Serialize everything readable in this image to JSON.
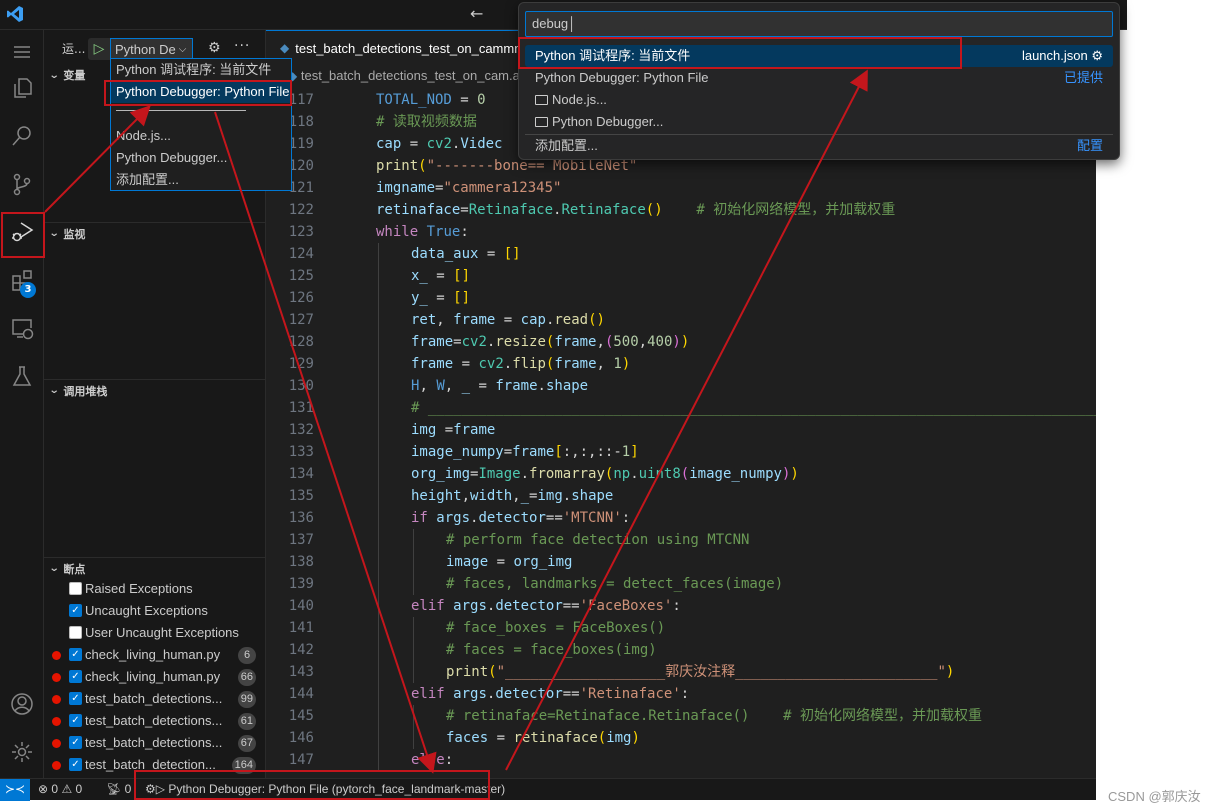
{
  "window": {
    "logo": "vscode-logo",
    "nav_back": "←",
    "nav_forward": "→"
  },
  "activity_bar": {
    "items": [
      {
        "name": "menu",
        "icon": "menu-icon"
      },
      {
        "name": "explorer",
        "icon": "files-icon"
      },
      {
        "name": "search",
        "icon": "search-icon"
      },
      {
        "name": "source-control",
        "icon": "source-control-icon"
      },
      {
        "name": "run-and-debug",
        "icon": "debug-icon",
        "active": true
      },
      {
        "name": "extensions",
        "icon": "extensions-icon",
        "badge": "3"
      },
      {
        "name": "remote-explorer",
        "icon": "remote-icon"
      },
      {
        "name": "testing",
        "icon": "flask-icon"
      },
      {
        "name": "accounts",
        "icon": "account-icon"
      },
      {
        "name": "settings",
        "icon": "gear-icon"
      }
    ]
  },
  "sidebar": {
    "title": "运...",
    "config_selected": "Python De",
    "sections": {
      "variables": "变量",
      "watch": "监视",
      "call_stack": "调用堆栈",
      "breakpoints": "断点"
    },
    "breakpoints": [
      {
        "label": "Raised Exceptions",
        "checked": false,
        "dot": false
      },
      {
        "label": "Uncaught Exceptions",
        "checked": true,
        "dot": false
      },
      {
        "label": "User Uncaught Exceptions",
        "checked": false,
        "dot": false
      },
      {
        "label": "check_living_human.py",
        "checked": true,
        "dot": true,
        "count": "6"
      },
      {
        "label": "check_living_human.py",
        "checked": true,
        "dot": true,
        "count": "66"
      },
      {
        "label": "test_batch_detections...",
        "checked": true,
        "dot": true,
        "count": "99"
      },
      {
        "label": "test_batch_detections...",
        "checked": true,
        "dot": true,
        "count": "61"
      },
      {
        "label": "test_batch_detections...",
        "checked": true,
        "dot": true,
        "count": "67"
      },
      {
        "label": "test_batch_detection...",
        "checked": true,
        "dot": true,
        "count": "164"
      }
    ]
  },
  "config_dropdown": {
    "items": [
      {
        "label": "Python 调试程序: 当前文件",
        "selected": false
      },
      {
        "label": "Python Debugger: Python File",
        "selected": true
      },
      {
        "label": "——————————",
        "separator": true
      },
      {
        "label": "Node.js...",
        "selected": false
      },
      {
        "label": "Python Debugger...",
        "selected": false
      },
      {
        "label": "添加配置...",
        "selected": false
      }
    ]
  },
  "editor": {
    "tab_label": "test_batch_detections_test_on_cammm",
    "breadcrumb": "test_batch_detections_test_on_cam.ar",
    "lines": [
      {
        "n": "117",
        "html": "<span class='b'>TOTAL_NOD</span> <span class='w'>=</span> <span class='n'>0</span>",
        "indent": 0
      },
      {
        "n": "118",
        "html": "<span class='c'># 读取视频数据</span>",
        "indent": 0
      },
      {
        "n": "119",
        "html": "<span class='v'>cap</span> <span class='w'>=</span> <span class='t'>cv2</span><span class='w'>.</span><span class='v'>Videc</span>",
        "indent": 0
      },
      {
        "n": "120",
        "html": "<span class='f'>print</span><span class='p'>(</span><span class='s'>\"-------bone== MobileNet\"</span>",
        "indent": 0
      },
      {
        "n": "121",
        "html": "<span class='v'>imgname</span><span class='w'>=</span><span class='s'>\"cammera12345\"</span>",
        "indent": 0
      },
      {
        "n": "122",
        "html": "<span class='v'>retinaface</span><span class='w'>=</span><span class='t'>Retinaface</span><span class='w'>.</span><span class='t'>Retinaface</span><span class='p'>()</span>    <span class='c'># 初始化网络模型，并加载权重</span>",
        "indent": 0
      },
      {
        "n": "123",
        "html": "<span class='k'>while</span> <span class='b'>True</span><span class='w'>:</span>",
        "indent": 0
      },
      {
        "n": "124",
        "html": "<span class='v'>data_aux</span> <span class='w'>=</span> <span class='p'>[]</span>",
        "indent": 1
      },
      {
        "n": "125",
        "html": "<span class='v'>x_</span> <span class='w'>=</span> <span class='p'>[]</span>",
        "indent": 1
      },
      {
        "n": "126",
        "html": "<span class='v'>y_</span> <span class='w'>=</span> <span class='p'>[]</span>",
        "indent": 1
      },
      {
        "n": "127",
        "html": "<span class='v'>ret</span><span class='w'>,</span> <span class='v'>frame</span> <span class='w'>=</span> <span class='v'>cap</span><span class='w'>.</span><span class='f'>read</span><span class='p'>()</span>",
        "indent": 1
      },
      {
        "n": "128",
        "html": "<span class='v'>frame</span><span class='w'>=</span><span class='t'>cv2</span><span class='w'>.</span><span class='f'>resize</span><span class='p'>(</span><span class='v'>frame</span><span class='w'>,</span><span class='p2'>(</span><span class='n'>500</span><span class='w'>,</span><span class='n'>400</span><span class='p2'>)</span><span class='p'>)</span>",
        "indent": 1
      },
      {
        "n": "129",
        "html": "<span class='v'>frame</span> <span class='w'>=</span> <span class='t'>cv2</span><span class='w'>.</span><span class='f'>flip</span><span class='p'>(</span><span class='v'>frame</span><span class='w'>,</span> <span class='n'>1</span><span class='p'>)</span>",
        "indent": 1
      },
      {
        "n": "130",
        "html": "<span class='b'>H</span><span class='w'>,</span> <span class='b'>W</span><span class='w'>,</span> <span class='v'>_</span> <span class='w'>=</span> <span class='v'>frame</span><span class='w'>.</span><span class='v'>shape</span>",
        "indent": 1
      },
      {
        "n": "131",
        "html": "<span class='c'># ______________________________________________________________________________________________</span>",
        "indent": 1
      },
      {
        "n": "132",
        "html": "<span class='v'>img</span> <span class='w'>=</span><span class='v'>frame</span>",
        "indent": 1
      },
      {
        "n": "133",
        "html": "<span class='v'>image_numpy</span><span class='w'>=</span><span class='v'>frame</span><span class='p'>[</span><span class='w'>:,:,::-</span><span class='n'>1</span><span class='p'>]</span>",
        "indent": 1
      },
      {
        "n": "134",
        "html": "<span class='v'>org_img</span><span class='w'>=</span><span class='t'>Image</span><span class='w'>.</span><span class='f'>fromarray</span><span class='p'>(</span><span class='t'>np</span><span class='w'>.</span><span class='t'>uint8</span><span class='p2'>(</span><span class='v'>image_numpy</span><span class='p2'>)</span><span class='p'>)</span>",
        "indent": 1
      },
      {
        "n": "135",
        "html": "<span class='v'>height</span><span class='w'>,</span><span class='v'>width</span><span class='w'>,</span><span class='v'>_</span><span class='w'>=</span><span class='v'>img</span><span class='w'>.</span><span class='v'>shape</span>",
        "indent": 1
      },
      {
        "n": "136",
        "html": "<span class='k'>if</span> <span class='v'>args</span><span class='w'>.</span><span class='v'>detector</span><span class='w'>==</span><span class='s'>'MTCNN'</span><span class='w'>:</span>",
        "indent": 1
      },
      {
        "n": "137",
        "html": "<span class='c'># perform face detection using MTCNN</span>",
        "indent": 2
      },
      {
        "n": "138",
        "html": "<span class='v'>image</span> <span class='w'>=</span> <span class='v'>org_img</span>",
        "indent": 2
      },
      {
        "n": "139",
        "html": "<span class='c'># faces, landmarks = detect_faces(image)</span>",
        "indent": 2
      },
      {
        "n": "140",
        "html": "<span class='k'>elif</span> <span class='v'>args</span><span class='w'>.</span><span class='v'>detector</span><span class='w'>==</span><span class='s'>'FaceBoxes'</span><span class='w'>:</span>",
        "indent": 1
      },
      {
        "n": "141",
        "html": "<span class='c'># face_boxes = FaceBoxes()</span>",
        "indent": 2
      },
      {
        "n": "142",
        "html": "<span class='c'># faces = face_boxes(img)</span>",
        "indent": 2
      },
      {
        "n": "143",
        "html": "<span class='f'>print</span><span class='p'>(</span><span class='s'>\"___________________郭庆汝注释________________________\"</span><span class='p'>)</span>",
        "indent": 2
      },
      {
        "n": "144",
        "html": "<span class='k'>elif</span> <span class='v'>args</span><span class='w'>.</span><span class='v'>detector</span><span class='w'>==</span><span class='s'>'Retinaface'</span><span class='w'>:</span>",
        "indent": 1
      },
      {
        "n": "145",
        "html": "<span class='c'># retinaface=Retinaface.Retinaface()    # 初始化网络模型，并加载权重</span>",
        "indent": 2
      },
      {
        "n": "146",
        "html": "<span class='v'>faces</span> <span class='w'>=</span> <span class='f'>retinaface</span><span class='p'>(</span><span class='v'>img</span><span class='p'>)</span>",
        "indent": 2
      },
      {
        "n": "147",
        "html": "<span class='k'>else</span><span class='w'>:</span>",
        "indent": 1
      }
    ]
  },
  "quick_pick": {
    "input_value": "debug",
    "items": [
      {
        "label": "Python 调试程序: 当前文件",
        "right": "launch.json",
        "right_icon": "gear-icon",
        "selected": true
      },
      {
        "label": "Python Debugger: Python File",
        "right": "已提供",
        "link": true
      },
      {
        "label": "Node.js...",
        "folder": true
      },
      {
        "label": "Python Debugger...",
        "folder": true
      },
      {
        "label": "添加配置...",
        "right": "配置",
        "link": true
      }
    ]
  },
  "status_bar": {
    "errors": "0",
    "warnings": "0",
    "ports": "0",
    "debug_config": "Python Debugger: Python File (pytorch_face_landmark-master)"
  },
  "watermark": "CSDN @郭庆汝",
  "colors": {
    "accent": "#0078d4",
    "annotation_red": "#c4161c",
    "breakpoint": "#e51400"
  }
}
